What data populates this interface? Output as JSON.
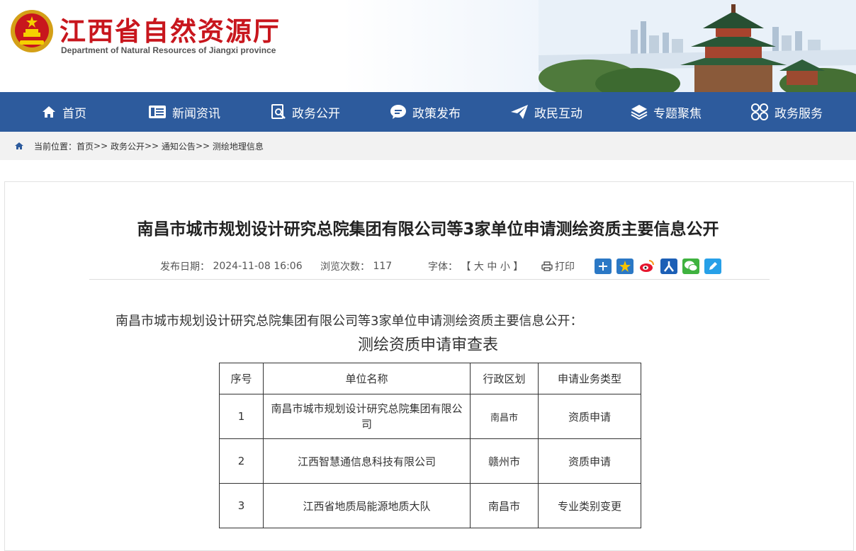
{
  "header": {
    "title": "江西省自然资源厅",
    "subtitle": "Department of Natural Resources of Jiangxi province"
  },
  "nav": {
    "items": [
      {
        "label": "首页",
        "icon": "home-icon"
      },
      {
        "label": "新闻资讯",
        "icon": "news-icon"
      },
      {
        "label": "政务公开",
        "icon": "document-search-icon"
      },
      {
        "label": "政策发布",
        "icon": "chat-bubble-icon"
      },
      {
        "label": "政民互动",
        "icon": "paper-plane-icon"
      },
      {
        "label": "专题聚焦",
        "icon": "layers-icon"
      },
      {
        "label": "政务服务",
        "icon": "grid-circles-icon"
      }
    ]
  },
  "breadcrumb": {
    "prefix": "当前位置：",
    "items": [
      "首页",
      "政务公开",
      "通知公告",
      "测绘地理信息"
    ],
    "separator": ">>"
  },
  "article": {
    "title": "南昌市城市规划设计研究总院集团有限公司等3家单位申请测绘资质主要信息公开",
    "date_label": "发布日期：",
    "date": "2024-11-08 16:06",
    "views_label": "浏览次数：",
    "views": "117",
    "font_label": "字体：",
    "font_open": "【",
    "font_large": "大",
    "font_medium": "中",
    "font_small": "小",
    "font_close": "】",
    "print_label": "打印",
    "share_icons": [
      "plus-share-icon",
      "star-share-icon",
      "weibo-icon",
      "renren-icon",
      "wechat-icon",
      "pencil-share-icon"
    ],
    "intro": "南昌市城市规划设计研究总院集团有限公司等3家单位申请测绘资质主要信息公开：",
    "table_title": "测绘资质申请审查表",
    "table": {
      "headers": [
        "序号",
        "单位名称",
        "行政区划",
        "申请业务类型"
      ],
      "rows": [
        [
          "1",
          "南昌市城市规划设计研究总院集团有限公司",
          "南昌市",
          "资质申请"
        ],
        [
          "2",
          "江西智慧通信息科技有限公司",
          "赣州市",
          "资质申请"
        ],
        [
          "3",
          "江西省地质局能源地质大队",
          "南昌市",
          "专业类别变更"
        ]
      ]
    }
  },
  "colors": {
    "brand_red": "#c8161d",
    "nav_blue": "#2d5b9d",
    "breadcrumb_bg": "#f2f2f2"
  }
}
